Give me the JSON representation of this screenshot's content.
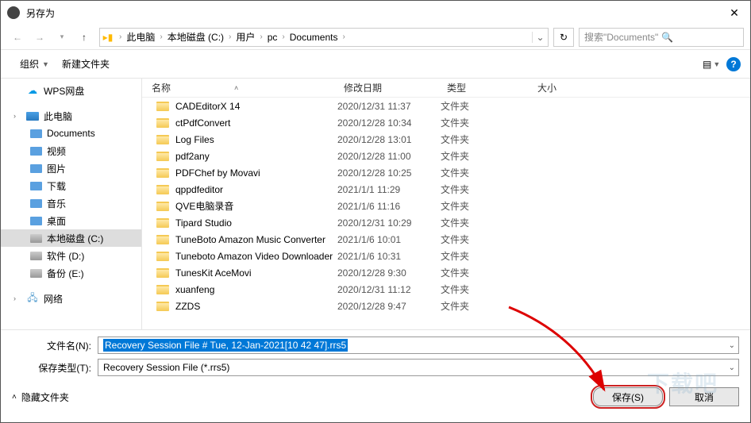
{
  "window": {
    "title": "另存为"
  },
  "nav": {
    "breadcrumb": [
      "此电脑",
      "本地磁盘 (C:)",
      "用户",
      "pc",
      "Documents"
    ],
    "search_placeholder": "搜索\"Documents\""
  },
  "toolbar": {
    "organize": "组织",
    "new_folder": "新建文件夹"
  },
  "sidebar": {
    "items": [
      {
        "label": "WPS网盘",
        "kind": "cloud",
        "indent": 0
      },
      {
        "label": "此电脑",
        "kind": "pc",
        "indent": 0,
        "expandable": true
      },
      {
        "label": "Documents",
        "kind": "folder",
        "indent": 1
      },
      {
        "label": "视频",
        "kind": "folder",
        "indent": 1
      },
      {
        "label": "图片",
        "kind": "folder",
        "indent": 1
      },
      {
        "label": "下载",
        "kind": "folder",
        "indent": 1
      },
      {
        "label": "音乐",
        "kind": "folder",
        "indent": 1
      },
      {
        "label": "桌面",
        "kind": "folder",
        "indent": 1
      },
      {
        "label": "本地磁盘 (C:)",
        "kind": "disk",
        "indent": 1,
        "selected": true
      },
      {
        "label": "软件 (D:)",
        "kind": "disk",
        "indent": 1
      },
      {
        "label": "备份 (E:)",
        "kind": "disk",
        "indent": 1
      },
      {
        "label": "网络",
        "kind": "net",
        "indent": 0,
        "expandable": true
      }
    ]
  },
  "columns": {
    "name": "名称",
    "date": "修改日期",
    "type": "类型",
    "size": "大小"
  },
  "files": [
    {
      "name": "CADEditorX 14",
      "date": "2020/12/31 11:37",
      "type": "文件夹"
    },
    {
      "name": "ctPdfConvert",
      "date": "2020/12/28 10:34",
      "type": "文件夹"
    },
    {
      "name": "Log Files",
      "date": "2020/12/28 13:01",
      "type": "文件夹"
    },
    {
      "name": "pdf2any",
      "date": "2020/12/28 11:00",
      "type": "文件夹"
    },
    {
      "name": "PDFChef by Movavi",
      "date": "2020/12/28 10:25",
      "type": "文件夹"
    },
    {
      "name": "qppdfeditor",
      "date": "2021/1/1 11:29",
      "type": "文件夹"
    },
    {
      "name": "QVE电脑录音",
      "date": "2021/1/6 11:16",
      "type": "文件夹"
    },
    {
      "name": "Tipard Studio",
      "date": "2020/12/31 10:29",
      "type": "文件夹"
    },
    {
      "name": "TuneBoto Amazon Music Converter",
      "date": "2021/1/6 10:01",
      "type": "文件夹"
    },
    {
      "name": "Tuneboto Amazon Video Downloader",
      "date": "2021/1/6 10:31",
      "type": "文件夹"
    },
    {
      "name": "TunesKit AceMovi",
      "date": "2020/12/28 9:30",
      "type": "文件夹"
    },
    {
      "name": "xuanfeng",
      "date": "2020/12/31 11:12",
      "type": "文件夹"
    },
    {
      "name": "ZZDS",
      "date": "2020/12/28 9:47",
      "type": "文件夹"
    }
  ],
  "form": {
    "filename_label": "文件名(N):",
    "filename_value": "Recovery Session File # Tue, 12-Jan-2021[10 42 47].rrs5",
    "filetype_label": "保存类型(T):",
    "filetype_value": "Recovery Session File  (*.rrs5)"
  },
  "footer": {
    "hide_folders": "隐藏文件夹",
    "save": "保存(S)",
    "cancel": "取消"
  },
  "watermark": "下载吧"
}
